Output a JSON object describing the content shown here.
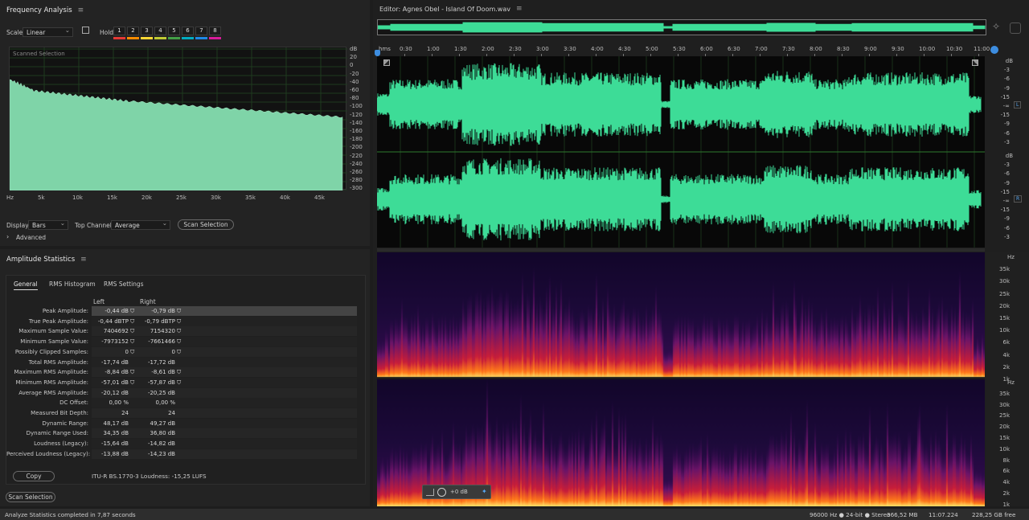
{
  "freq": {
    "title": "Frequency Analysis",
    "scale_label": "Scale:",
    "scale_value": "Linear",
    "hold_label": "Hold:",
    "hold": [
      {
        "n": "1",
        "c": "#e53935"
      },
      {
        "n": "2",
        "c": "#fb8c00"
      },
      {
        "n": "3",
        "c": "#fdd835"
      },
      {
        "n": "4",
        "c": "#c0ca33"
      },
      {
        "n": "5",
        "c": "#43a047"
      },
      {
        "n": "6",
        "c": "#00acc1"
      },
      {
        "n": "7",
        "c": "#1e88e5"
      },
      {
        "n": "8",
        "c": "#d81b9a"
      }
    ],
    "scanned_label": "Scanned Selection",
    "db_ticks": [
      "dB",
      "20",
      "0",
      "-20",
      "-40",
      "-60",
      "-80",
      "-100",
      "-120",
      "-140",
      "-160",
      "-180",
      "-200",
      "-220",
      "-240",
      "-260",
      "-280",
      "-300"
    ],
    "hz_ticks": [
      "Hz",
      "5k",
      "10k",
      "15k",
      "20k",
      "25k",
      "30k",
      "35k",
      "40k",
      "45k"
    ],
    "display_label": "Display:",
    "display_value": "Bars",
    "top_channel_label": "Top Channel:",
    "top_channel_value": "Average",
    "scan_selection": "Scan Selection",
    "advanced": "Advanced"
  },
  "amp": {
    "title": "Amplitude Statistics",
    "tabs": [
      "General",
      "RMS Histogram",
      "RMS Settings"
    ],
    "col_left": "Left",
    "col_right": "Right",
    "rows": [
      {
        "label": "Peak Amplitude:",
        "left": "-0,44 dB",
        "right": "-0,79 dB",
        "lm": true,
        "rm": true
      },
      {
        "label": "True Peak Amplitude:",
        "left": "-0,44 dBTP",
        "right": "-0,79 dBTP",
        "lm": true,
        "rm": true
      },
      {
        "label": "Maximum Sample Value:",
        "left": "7404692",
        "right": "7154320",
        "lm": true,
        "rm": true
      },
      {
        "label": "Minimum Sample Value:",
        "left": "-7973152",
        "right": "-7661466",
        "lm": true,
        "rm": true
      },
      {
        "label": "Possibly Clipped Samples:",
        "left": "0",
        "right": "0",
        "lm": true,
        "rm": true
      },
      {
        "label": "Total RMS Amplitude:",
        "left": "-17,74 dB",
        "right": "-17,72 dB",
        "lm": false,
        "rm": false
      },
      {
        "label": "Maximum RMS Amplitude:",
        "left": "-8,84 dB",
        "right": "-8,61 dB",
        "lm": true,
        "rm": true
      },
      {
        "label": "Minimum RMS Amplitude:",
        "left": "-57,01 dB",
        "right": "-57,87 dB",
        "lm": true,
        "rm": true
      },
      {
        "label": "Average RMS Amplitude:",
        "left": "-20,12 dB",
        "right": "-20,25 dB",
        "lm": false,
        "rm": false
      },
      {
        "label": "DC Offset:",
        "left": "0,00 %",
        "right": "0,00 %",
        "lm": false,
        "rm": false
      },
      {
        "label": "Measured Bit Depth:",
        "left": "24",
        "right": "24",
        "lm": false,
        "rm": false
      },
      {
        "label": "Dynamic Range:",
        "left": "48,17 dB",
        "right": "49,27 dB",
        "lm": false,
        "rm": false
      },
      {
        "label": "Dynamic Range Used:",
        "left": "34,35 dB",
        "right": "36,80 dB",
        "lm": false,
        "rm": false
      },
      {
        "label": "Loudness (Legacy):",
        "left": "-15,64 dB",
        "right": "-14,82 dB",
        "lm": false,
        "rm": false
      },
      {
        "label": "Perceived Loudness (Legacy):",
        "left": "-13,88 dB",
        "right": "-14,23 dB",
        "lm": false,
        "rm": false
      }
    ],
    "copy": "Copy",
    "loudness": "ITU-R BS.1770-3 Loudness: -15,25 LUFS",
    "scan_selection": "Scan Selection"
  },
  "editor": {
    "title": "Editor: Agnes Obel - Island Of Doom.wav",
    "time_ticks": [
      "hms",
      "0:30",
      "1:00",
      "1:30",
      "2:00",
      "2:30",
      "3:00",
      "3:30",
      "4:00",
      "4:30",
      "5:00",
      "5:30",
      "6:00",
      "6:30",
      "7:00",
      "7:30",
      "8:00",
      "8:30",
      "9:00",
      "9:30",
      "10:00",
      "10:30",
      "11:00"
    ],
    "db_ticks_l": [
      "dB",
      "-3",
      "-6",
      "-9",
      "-15",
      "-∞",
      "-15",
      "-9",
      "-6",
      "-3"
    ],
    "db_ticks_r": [
      "dB",
      "-3",
      "-6",
      "-9",
      "-15",
      "-∞",
      "-15",
      "-9",
      "-6",
      "-3"
    ],
    "ch_l": "L",
    "ch_r": "R",
    "spec_ticks_top": [
      "Hz",
      "35k",
      "30k",
      "25k",
      "20k",
      "15k",
      "10k",
      "6k",
      "4k",
      "2k",
      "1k"
    ],
    "spec_ticks_bot": [
      "Hz",
      "35k",
      "30k",
      "25k",
      "20k",
      "15k",
      "10k",
      "8k",
      "6k",
      "4k",
      "2k",
      "1k"
    ],
    "hud_value": "+0 dB",
    "wave_color": "#3ddc97"
  },
  "status": {
    "left": "Analyze Statistics completed in 7,87 seconds",
    "rate": "96000 Hz ● 24-bit ● Stereo",
    "size": "366,52 MB",
    "duration": "11:07.224",
    "free": "228,25 GB free"
  }
}
